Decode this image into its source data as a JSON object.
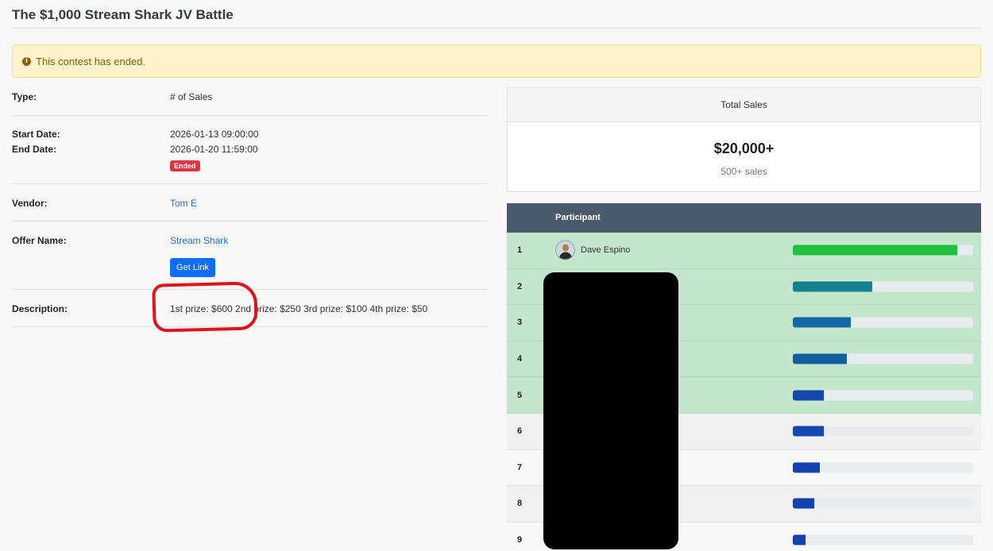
{
  "page": {
    "title": "The $1,000 Stream Shark JV Battle"
  },
  "alert": {
    "icon": "info-icon",
    "text": "This contest has ended."
  },
  "details": {
    "type_label": "Type:",
    "type_value": "# of Sales",
    "start_label": "Start Date:",
    "start_value": "2026-01-13 09:00:00",
    "end_label": "End Date:",
    "end_value": "2026-01-20 11:59:00",
    "status_badge": "Ended",
    "vendor_label": "Vendor:",
    "vendor_value": "Tom E",
    "offer_label": "Offer Name:",
    "offer_value": "Stream Shark",
    "get_link_label": "Get Link",
    "description_label": "Description:",
    "description_value": "1st prize: $600 2nd prize: $250 3rd prize: $100 4th prize: $50"
  },
  "summary": {
    "header": "Total Sales",
    "amount": "$20,000+",
    "count": "500+ sales"
  },
  "leaderboard": {
    "column_participant": "Participant",
    "rows": [
      {
        "rank": "1",
        "name": "Dave Espino",
        "progress": 0.91,
        "color": "#1fbf3f",
        "highlight": true
      },
      {
        "rank": "2",
        "name": "",
        "progress": 0.44,
        "color": "#17808e",
        "highlight": true
      },
      {
        "rank": "3",
        "name": "",
        "progress": 0.32,
        "color": "#1469a6",
        "highlight": true
      },
      {
        "rank": "4",
        "name": "",
        "progress": 0.3,
        "color": "#14609f",
        "highlight": true
      },
      {
        "rank": "5",
        "name": "",
        "progress": 0.17,
        "color": "#1448ad",
        "highlight": true
      },
      {
        "rank": "6",
        "name": "",
        "progress": 0.17,
        "color": "#1448ad",
        "highlight": false
      },
      {
        "rank": "7",
        "name": "",
        "progress": 0.15,
        "color": "#1440b0",
        "highlight": false
      },
      {
        "rank": "8",
        "name": "",
        "progress": 0.12,
        "color": "#1440b0",
        "highlight": false
      },
      {
        "rank": "9",
        "name": "",
        "progress": 0.07,
        "color": "#1440b0",
        "highlight": false
      }
    ]
  }
}
